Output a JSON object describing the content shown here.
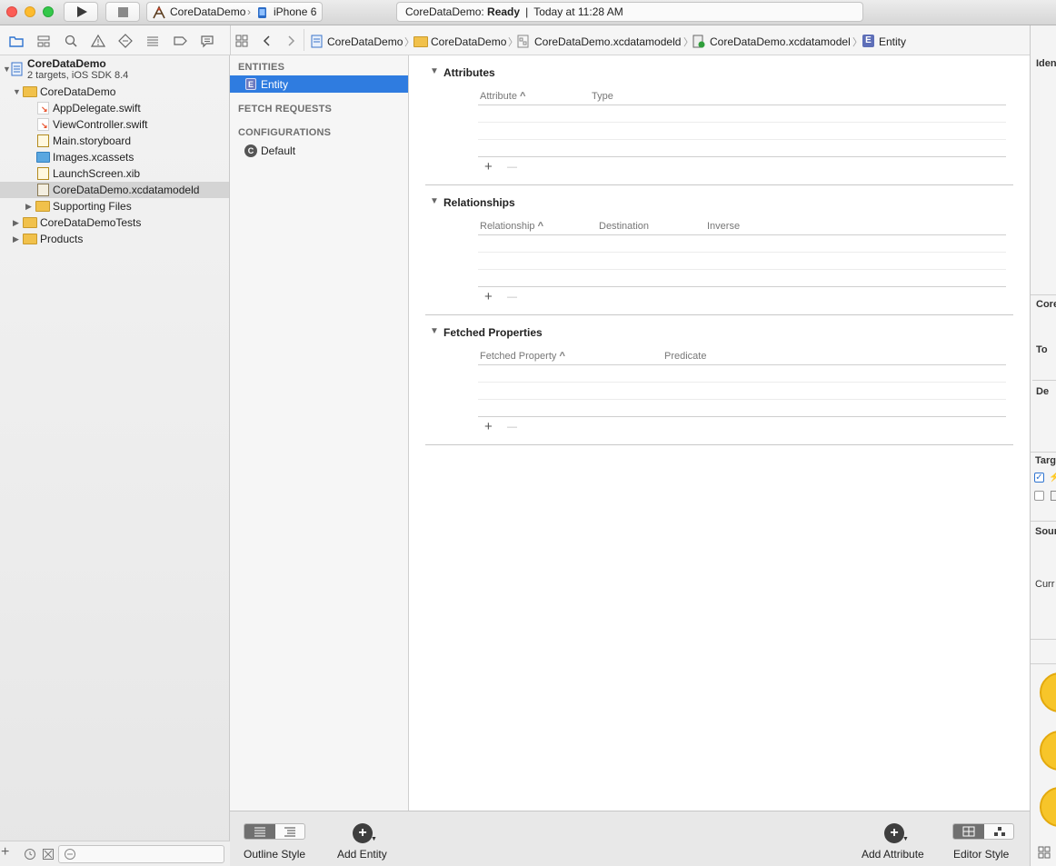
{
  "toolbar": {
    "run_icon": "play-icon",
    "stop_icon": "stop-icon",
    "scheme_name": "CoreDataDemo",
    "device_name": "iPhone 6",
    "status_prefix": "CoreDataDemo: ",
    "status_state": "Ready",
    "status_sep": "|",
    "status_time": "Today at 11:28 AM"
  },
  "breadcrumbs": [
    {
      "label": "CoreDataDemo",
      "icon": "project-icon"
    },
    {
      "label": "CoreDataDemo",
      "icon": "folder-icon"
    },
    {
      "label": "CoreDataDemo.xcdatamodeld",
      "icon": "datamodel-icon"
    },
    {
      "label": "CoreDataDemo.xcdatamodel",
      "icon": "model-version-icon"
    },
    {
      "label": "Entity",
      "icon": "entity-icon"
    }
  ],
  "navigator": {
    "project": {
      "name": "CoreDataDemo",
      "subtitle": "2 targets, iOS SDK 8.4"
    },
    "items": [
      {
        "label": "CoreDataDemo",
        "kind": "group"
      },
      {
        "label": "AppDelegate.swift",
        "kind": "swift"
      },
      {
        "label": "ViewController.swift",
        "kind": "swift"
      },
      {
        "label": "Main.storyboard",
        "kind": "storyboard"
      },
      {
        "label": "Images.xcassets",
        "kind": "assets"
      },
      {
        "label": "LaunchScreen.xib",
        "kind": "xib"
      },
      {
        "label": "CoreDataDemo.xcdatamodeld",
        "kind": "datamodel"
      },
      {
        "label": "Supporting Files",
        "kind": "group"
      },
      {
        "label": "CoreDataDemoTests",
        "kind": "group"
      },
      {
        "label": "Products",
        "kind": "group"
      }
    ]
  },
  "entities_panel": {
    "entities_header": "ENTITIES",
    "entity": "Entity",
    "entity_badge": "E",
    "fetch_header": "FETCH REQUESTS",
    "config_header": "CONFIGURATIONS",
    "config_default": "Default",
    "config_badge": "C"
  },
  "attributes": {
    "title": "Attributes",
    "col1": "Attribute",
    "col2": "Type"
  },
  "relationships": {
    "title": "Relationships",
    "col1": "Relationship",
    "col2": "Destination",
    "col3": "Inverse"
  },
  "fetched": {
    "title": "Fetched Properties",
    "col1": "Fetched Property",
    "col2": "Predicate"
  },
  "sort_glyph": "^",
  "plus_glyph": "+",
  "minus_glyph": "—",
  "inspector": {
    "labels": [
      "Ident",
      "Core",
      "To",
      "De",
      "Targ",
      "Sour",
      "Curr"
    ]
  },
  "bottombar": {
    "outline_style": "Outline Style",
    "add_entity": "Add Entity",
    "add_attribute": "Add Attribute",
    "editor_style": "Editor Style"
  }
}
